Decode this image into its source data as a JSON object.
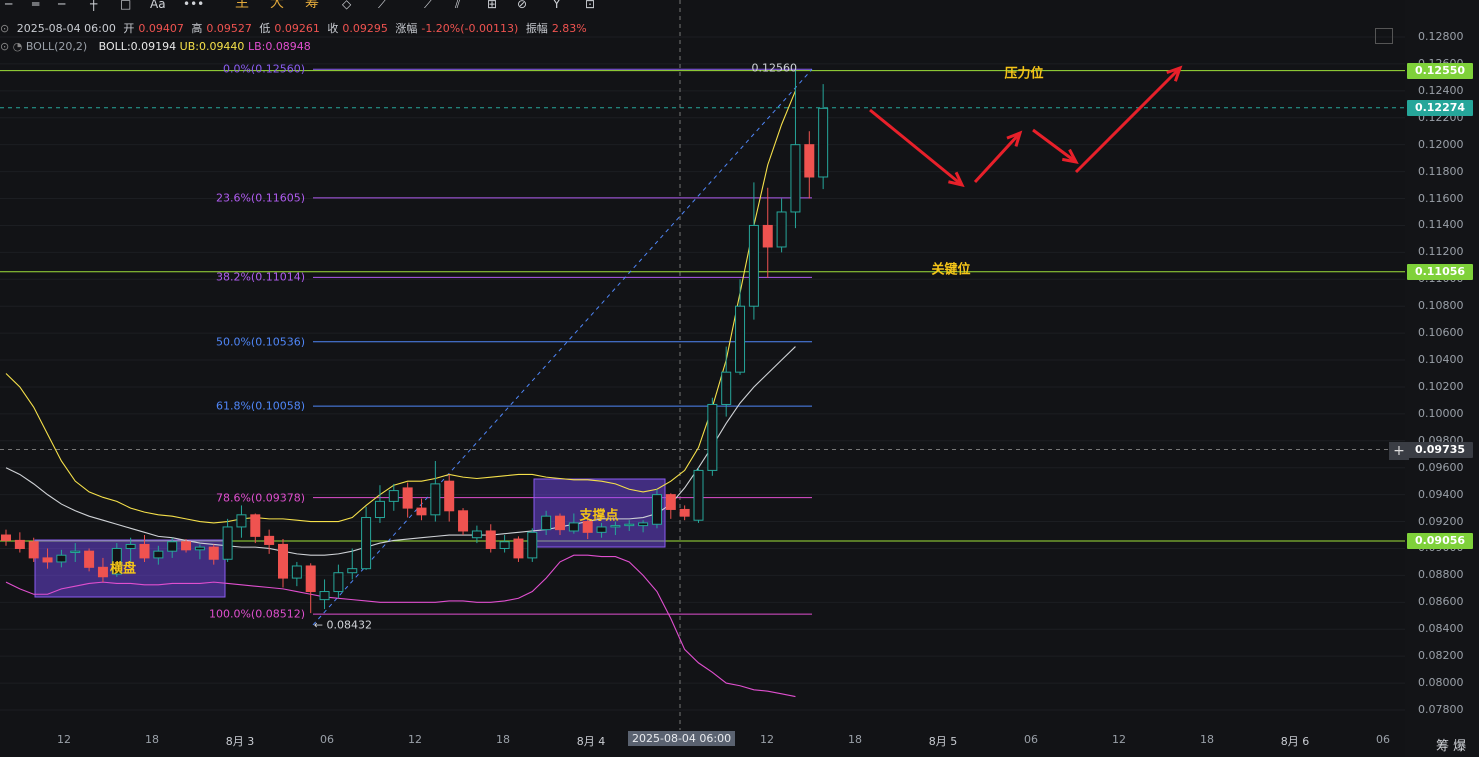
{
  "toolbar": {
    "items": [
      "─",
      "═",
      "─",
      "┼",
      "□",
      "Aa",
      "•••"
    ],
    "cn_items": [
      "主",
      "大",
      "筹"
    ],
    "tools": [
      "◇",
      "⟋",
      "⟋",
      "⫽",
      "⊞",
      "⊘",
      "Y",
      "⊡"
    ]
  },
  "ohlc": {
    "datetime": "2025-08-04 06:00",
    "open_label": "开",
    "open": "0.09407",
    "high_label": "高",
    "high": "0.09527",
    "low_label": "低",
    "low": "0.09261",
    "close_label": "收",
    "close": "0.09295",
    "change_label": "涨幅",
    "change": "-1.20%(-0.00113)",
    "amp_label": "振幅",
    "amp": "2.83%"
  },
  "boll": {
    "name": "BOLL(20,2)",
    "mid": "BOLL:0.09194",
    "ub": "UB:0.09440",
    "lb": "LB:0.08948"
  },
  "y_axis": [
    "0.12800",
    "0.12600",
    "0.12400",
    "0.12200",
    "0.12000",
    "0.11800",
    "0.11600",
    "0.11400",
    "0.11200",
    "0.11000",
    "0.10800",
    "0.10600",
    "0.10400",
    "0.10200",
    "0.10000",
    "0.09800",
    "0.09600",
    "0.09400",
    "0.09200",
    "0.09000",
    "0.08800",
    "0.08600",
    "0.08400",
    "0.08200",
    "0.08000",
    "0.07800"
  ],
  "x_axis": [
    {
      "label": "12",
      "day": false
    },
    {
      "label": "18",
      "day": false
    },
    {
      "label": "8月 3",
      "day": true
    },
    {
      "label": "06",
      "day": false
    },
    {
      "label": "12",
      "day": false
    },
    {
      "label": "18",
      "day": false
    },
    {
      "label": "8月 4",
      "day": true
    },
    {
      "label": "12",
      "day": false
    },
    {
      "label": "18",
      "day": false
    },
    {
      "label": "8月 5",
      "day": true
    },
    {
      "label": "06",
      "day": false
    },
    {
      "label": "12",
      "day": false
    },
    {
      "label": "18",
      "day": false
    },
    {
      "label": "8月 6",
      "day": true
    },
    {
      "label": "06",
      "day": false
    }
  ],
  "crosshair_time": "2025-08-04 06:00",
  "price_tags": [
    {
      "value": "0.12550",
      "color": "#7fd13a"
    },
    {
      "value": "0.12274",
      "color": "#26a69a"
    },
    {
      "value": "0.11056",
      "color": "#7fd13a"
    },
    {
      "value": "0.09735",
      "color": "#3a3d44"
    },
    {
      "value": "0.09056",
      "color": "#7fd13a"
    }
  ],
  "fib_levels": [
    {
      "label": "0.0%(0.12560)",
      "price": 0.1256,
      "color": "#8a5cf0"
    },
    {
      "label": "23.6%(0.11605)",
      "price": 0.11605,
      "color": "#b05cf0"
    },
    {
      "label": "38.2%(0.11014)",
      "price": 0.11014,
      "color": "#b05cf0"
    },
    {
      "label": "50.0%(0.10536)",
      "price": 0.10536,
      "color": "#4f86f7"
    },
    {
      "label": "61.8%(0.10058)",
      "price": 0.10058,
      "color": "#4f86f7"
    },
    {
      "label": "78.6%(0.09378)",
      "price": 0.09378,
      "color": "#e04fcf"
    },
    {
      "label": "100.0%(0.08512)",
      "price": 0.08512,
      "color": "#e04fcf"
    }
  ],
  "high_mark": "0.12560",
  "low_mark": "← 0.08432",
  "annotations": {
    "resistance": "压力位",
    "key_level": "关键位",
    "support": "支撑点",
    "consolidation": "横盘"
  },
  "bottom_buttons": "筹 爆",
  "chart_data": {
    "type": "candlestick",
    "y_range": [
      0.0775,
      0.129
    ],
    "series": [
      {
        "o": 0.091,
        "h": 0.0914,
        "l": 0.0902,
        "c": 0.0906
      },
      {
        "o": 0.0906,
        "h": 0.0912,
        "l": 0.0897,
        "c": 0.09
      },
      {
        "o": 0.0905,
        "h": 0.0908,
        "l": 0.089,
        "c": 0.0893
      },
      {
        "o": 0.0893,
        "h": 0.09,
        "l": 0.0885,
        "c": 0.089
      },
      {
        "o": 0.089,
        "h": 0.0899,
        "l": 0.0886,
        "c": 0.0895
      },
      {
        "o": 0.0897,
        "h": 0.0904,
        "l": 0.089,
        "c": 0.0898
      },
      {
        "o": 0.0898,
        "h": 0.09,
        "l": 0.0883,
        "c": 0.0886
      },
      {
        "o": 0.0886,
        "h": 0.0893,
        "l": 0.0875,
        "c": 0.0879
      },
      {
        "o": 0.0881,
        "h": 0.0904,
        "l": 0.0879,
        "c": 0.09
      },
      {
        "o": 0.09,
        "h": 0.0908,
        "l": 0.0889,
        "c": 0.0903
      },
      {
        "o": 0.0903,
        "h": 0.091,
        "l": 0.089,
        "c": 0.0893
      },
      {
        "o": 0.0893,
        "h": 0.0902,
        "l": 0.0888,
        "c": 0.0898
      },
      {
        "o": 0.0898,
        "h": 0.0908,
        "l": 0.0893,
        "c": 0.0905
      },
      {
        "o": 0.0905,
        "h": 0.0907,
        "l": 0.0897,
        "c": 0.0899
      },
      {
        "o": 0.0899,
        "h": 0.0903,
        "l": 0.0892,
        "c": 0.0901
      },
      {
        "o": 0.0901,
        "h": 0.0903,
        "l": 0.0888,
        "c": 0.0892
      },
      {
        "o": 0.0892,
        "h": 0.0922,
        "l": 0.089,
        "c": 0.0916
      },
      {
        "o": 0.0916,
        "h": 0.0932,
        "l": 0.0908,
        "c": 0.0925
      },
      {
        "o": 0.0925,
        "h": 0.0926,
        "l": 0.0904,
        "c": 0.0909
      },
      {
        "o": 0.0909,
        "h": 0.0914,
        "l": 0.0896,
        "c": 0.0903
      },
      {
        "o": 0.0903,
        "h": 0.0907,
        "l": 0.0871,
        "c": 0.0878
      },
      {
        "o": 0.0878,
        "h": 0.089,
        "l": 0.0872,
        "c": 0.0887
      },
      {
        "o": 0.0887,
        "h": 0.0889,
        "l": 0.0852,
        "c": 0.0868
      },
      {
        "o": 0.0862,
        "h": 0.0877,
        "l": 0.0855,
        "c": 0.0868
      },
      {
        "o": 0.0868,
        "h": 0.0888,
        "l": 0.0863,
        "c": 0.0882
      },
      {
        "o": 0.0882,
        "h": 0.09,
        "l": 0.0877,
        "c": 0.0885
      },
      {
        "o": 0.0885,
        "h": 0.0931,
        "l": 0.0884,
        "c": 0.0923
      },
      {
        "o": 0.0923,
        "h": 0.0947,
        "l": 0.0919,
        "c": 0.0935
      },
      {
        "o": 0.0935,
        "h": 0.0948,
        "l": 0.0928,
        "c": 0.0943
      },
      {
        "o": 0.0945,
        "h": 0.0949,
        "l": 0.0923,
        "c": 0.093
      },
      {
        "o": 0.093,
        "h": 0.0937,
        "l": 0.0921,
        "c": 0.0925
      },
      {
        "o": 0.0925,
        "h": 0.0965,
        "l": 0.092,
        "c": 0.0948
      },
      {
        "o": 0.095,
        "h": 0.0955,
        "l": 0.092,
        "c": 0.0928
      },
      {
        "o": 0.0928,
        "h": 0.093,
        "l": 0.091,
        "c": 0.0913
      },
      {
        "o": 0.0908,
        "h": 0.0917,
        "l": 0.0904,
        "c": 0.0913
      },
      {
        "o": 0.0913,
        "h": 0.0918,
        "l": 0.0897,
        "c": 0.09
      },
      {
        "o": 0.09,
        "h": 0.091,
        "l": 0.0897,
        "c": 0.0905
      },
      {
        "o": 0.0907,
        "h": 0.0909,
        "l": 0.089,
        "c": 0.0893
      },
      {
        "o": 0.0893,
        "h": 0.0915,
        "l": 0.089,
        "c": 0.0912
      },
      {
        "o": 0.0914,
        "h": 0.0928,
        "l": 0.091,
        "c": 0.0924
      },
      {
        "o": 0.0924,
        "h": 0.0926,
        "l": 0.091,
        "c": 0.0914
      },
      {
        "o": 0.0913,
        "h": 0.0926,
        "l": 0.0911,
        "c": 0.0919
      },
      {
        "o": 0.092,
        "h": 0.0922,
        "l": 0.0907,
        "c": 0.0912
      },
      {
        "o": 0.0912,
        "h": 0.0919,
        "l": 0.0908,
        "c": 0.0916
      },
      {
        "o": 0.0916,
        "h": 0.092,
        "l": 0.091,
        "c": 0.0917
      },
      {
        "o": 0.0917,
        "h": 0.0921,
        "l": 0.0913,
        "c": 0.0918
      },
      {
        "o": 0.0917,
        "h": 0.0921,
        "l": 0.0912,
        "c": 0.0919
      },
      {
        "o": 0.0918,
        "h": 0.0944,
        "l": 0.0915,
        "c": 0.094
      },
      {
        "o": 0.094,
        "h": 0.0941,
        "l": 0.0922,
        "c": 0.0929
      },
      {
        "o": 0.0929,
        "h": 0.0932,
        "l": 0.0921,
        "c": 0.0924
      },
      {
        "o": 0.0921,
        "h": 0.096,
        "l": 0.0919,
        "c": 0.0958
      },
      {
        "o": 0.0958,
        "h": 0.1012,
        "l": 0.0954,
        "c": 0.1007
      },
      {
        "o": 0.1007,
        "h": 0.105,
        "l": 0.0998,
        "c": 0.1031
      },
      {
        "o": 0.1031,
        "h": 0.11,
        "l": 0.1029,
        "c": 0.108
      },
      {
        "o": 0.108,
        "h": 0.1172,
        "l": 0.107,
        "c": 0.114
      },
      {
        "o": 0.114,
        "h": 0.1168,
        "l": 0.1101,
        "c": 0.1124
      },
      {
        "o": 0.1124,
        "h": 0.116,
        "l": 0.112,
        "c": 0.115
      },
      {
        "o": 0.115,
        "h": 0.1256,
        "l": 0.1138,
        "c": 0.12
      },
      {
        "o": 0.12,
        "h": 0.121,
        "l": 0.116,
        "c": 0.1176
      },
      {
        "o": 0.1176,
        "h": 0.1245,
        "l": 0.1167,
        "c": 0.1227
      }
    ],
    "boll_upper": [
      0.103,
      0.102,
      0.1005,
      0.0985,
      0.0965,
      0.095,
      0.0942,
      0.0938,
      0.0935,
      0.093,
      0.0927,
      0.0925,
      0.0924,
      0.0922,
      0.092,
      0.0919,
      0.092,
      0.0922,
      0.0923,
      0.0922,
      0.0922,
      0.0921,
      0.092,
      0.092,
      0.092,
      0.0923,
      0.0932,
      0.094,
      0.0947,
      0.095,
      0.095,
      0.0952,
      0.0955,
      0.0953,
      0.0952,
      0.0953,
      0.0954,
      0.0955,
      0.0955,
      0.0953,
      0.0952,
      0.0951,
      0.0951,
      0.095,
      0.0948,
      0.0944,
      0.0942,
      0.0944,
      0.095,
      0.0958,
      0.0975,
      0.1005,
      0.104,
      0.109,
      0.114,
      0.1185,
      0.1215,
      0.124
    ],
    "boll_mid": [
      0.096,
      0.0955,
      0.0948,
      0.094,
      0.0933,
      0.0928,
      0.0924,
      0.0921,
      0.0918,
      0.0915,
      0.0912,
      0.0909,
      0.0908,
      0.0906,
      0.0904,
      0.0903,
      0.0902,
      0.0901,
      0.0901,
      0.09,
      0.0898,
      0.0896,
      0.0895,
      0.0895,
      0.0896,
      0.0898,
      0.0901,
      0.0904,
      0.0906,
      0.0907,
      0.0908,
      0.0909,
      0.091,
      0.091,
      0.091,
      0.091,
      0.0911,
      0.0912,
      0.0913,
      0.0914,
      0.0916,
      0.0918,
      0.092,
      0.0922,
      0.0922,
      0.0922,
      0.0923,
      0.0926,
      0.0933,
      0.0945,
      0.096,
      0.0976,
      0.0993,
      0.1008,
      0.102,
      0.103,
      0.104,
      0.105
    ],
    "boll_lower": [
      0.0875,
      0.087,
      0.0866,
      0.0866,
      0.087,
      0.0872,
      0.0874,
      0.0875,
      0.0874,
      0.0874,
      0.0873,
      0.0873,
      0.0874,
      0.0874,
      0.0874,
      0.0875,
      0.0874,
      0.0873,
      0.0872,
      0.0871,
      0.087,
      0.0868,
      0.0866,
      0.0864,
      0.0863,
      0.0862,
      0.0861,
      0.086,
      0.086,
      0.086,
      0.086,
      0.086,
      0.0861,
      0.0861,
      0.086,
      0.086,
      0.0861,
      0.0863,
      0.0868,
      0.0878,
      0.089,
      0.0895,
      0.0895,
      0.0894,
      0.0894,
      0.089,
      0.088,
      0.0868,
      0.0848,
      0.0825,
      0.0815,
      0.0808,
      0.08,
      0.0798,
      0.0795,
      0.0794,
      0.0792,
      0.079
    ]
  }
}
